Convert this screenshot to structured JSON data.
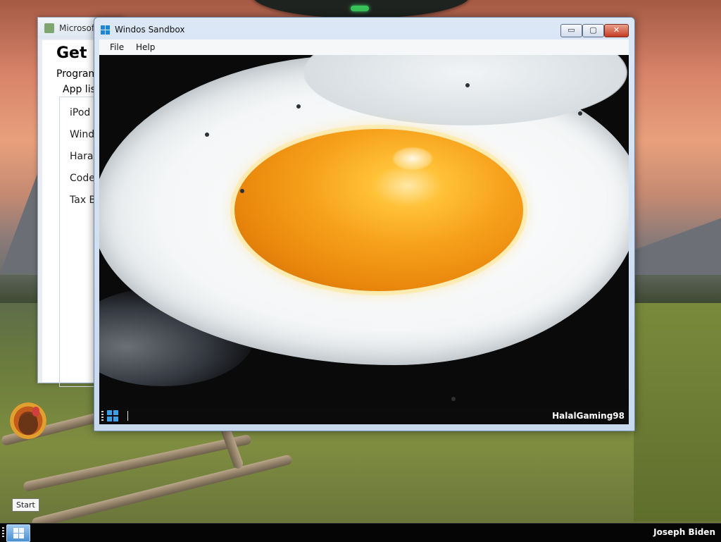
{
  "background_window": {
    "title": "Microsoft",
    "heading": "Get p",
    "subheading": "Program",
    "list_label": "App list",
    "items": [
      "iPod",
      "Wind",
      "Hara",
      "Code",
      "Tax B"
    ]
  },
  "sandbox_window": {
    "title": "Windos Sandbox",
    "menu": {
      "file": "File",
      "help": "Help"
    },
    "caption_buttons": {
      "minimize": "▭",
      "maximize": "▢",
      "close": "✕"
    },
    "inner_taskbar": {
      "user": "HalalGaming98"
    }
  },
  "tooltip": {
    "start": "Start"
  },
  "taskbar": {
    "user": "Joseph Biden"
  },
  "colors": {
    "window_chrome": "#c8d9ee",
    "close_button": "#c53b22",
    "taskbar": "#050505",
    "gadget_led": "#39c25a"
  },
  "icons": [
    "windows-logo-icon",
    "app-icon",
    "turkey-mascot-icon"
  ]
}
